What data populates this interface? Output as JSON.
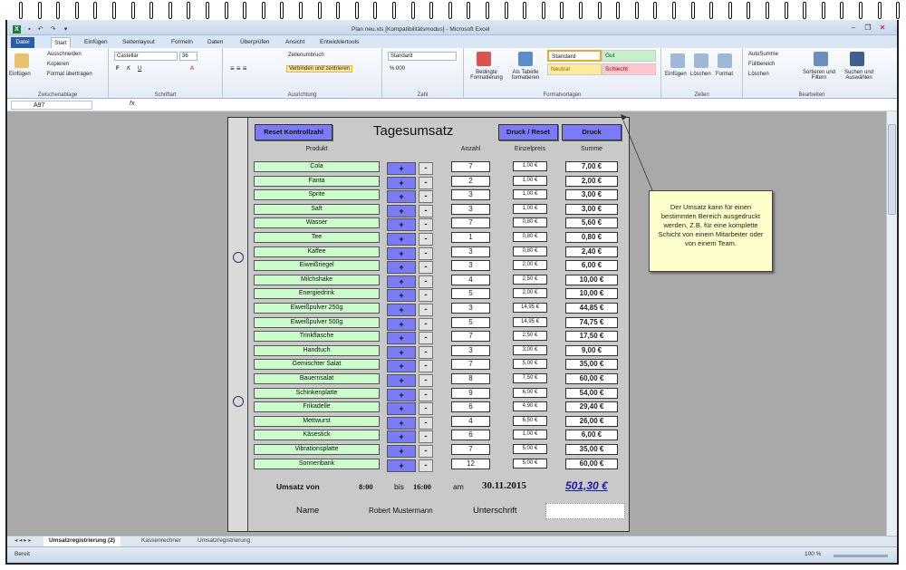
{
  "window": {
    "title": "Plan neu.xls  [Kompatibilitätsmodus]  -  Microsoft Excel"
  },
  "ribbon": {
    "tabs": [
      "Datei",
      "Start",
      "Einfügen",
      "Seitenlayout",
      "Formeln",
      "Daten",
      "Überprüfen",
      "Ansicht",
      "Entwicklertools"
    ],
    "clipboard": {
      "paste": "Einfügen",
      "cut": "Ausschneiden",
      "copy": "Kopieren",
      "format_painter": "Format übertragen",
      "group": "Zwischenablage"
    },
    "font": {
      "name": "Castellar",
      "size": "36",
      "group": "Schriftart"
    },
    "alignment": {
      "wrap": "Zeilenumbruch",
      "merge": "Verbinden und zentrieren",
      "group": "Ausrichtung"
    },
    "number": {
      "format": "Standard",
      "group": "Zahl"
    },
    "styles": {
      "conditional": "Bedingte Formatierung",
      "as_table": "Als Tabelle formatieren",
      "standard": "Standard",
      "gut": "Gut",
      "neutral": "Neutral",
      "schlecht": "Schlecht",
      "group": "Formatvorlagen"
    },
    "cells": {
      "insert": "Einfügen",
      "delete": "Löschen",
      "format": "Format",
      "group": "Zellen"
    },
    "editing": {
      "autosum": "AutoSumme",
      "fill": "Füllbereich",
      "clear": "Löschen",
      "sort": "Sortieren und Filtern",
      "find": "Suchen und Auswählen",
      "group": "Bearbeiten"
    }
  },
  "formula_bar": {
    "cell_ref": "A97",
    "fx": "fx",
    "content": ""
  },
  "sheet": {
    "title": "Tagesumsatz",
    "buttons": {
      "reset": "Reset Kontrollzahl",
      "print_reset": "Druck / Reset",
      "print": "Druck"
    },
    "headers": {
      "product": "Produkt",
      "qty": "Anzahl",
      "unit_price": "Einzelpreis",
      "sum": "Summe"
    },
    "plus_label": "+",
    "minus_label": "-",
    "rows": [
      {
        "product": "Cola",
        "qty": "7",
        "price": "1,00 €",
        "sum": "7,00 €"
      },
      {
        "product": "Fanta",
        "qty": "2",
        "price": "1,00 €",
        "sum": "2,00 €"
      },
      {
        "product": "Sprite",
        "qty": "3",
        "price": "1,00 €",
        "sum": "3,00 €"
      },
      {
        "product": "Saft",
        "qty": "3",
        "price": "1,00 €",
        "sum": "3,00 €"
      },
      {
        "product": "Wasser",
        "qty": "7",
        "price": "0,80 €",
        "sum": "5,60 €"
      },
      {
        "product": "Tee",
        "qty": "1",
        "price": "0,80 €",
        "sum": "0,80 €"
      },
      {
        "product": "Kaffee",
        "qty": "3",
        "price": "0,80 €",
        "sum": "2,40 €"
      },
      {
        "product": "Eiweißriegel",
        "qty": "3",
        "price": "2,00 €",
        "sum": "6,00 €"
      },
      {
        "product": "Milchshake",
        "qty": "4",
        "price": "2,50 €",
        "sum": "10,00 €"
      },
      {
        "product": "Energiedrink",
        "qty": "5",
        "price": "2,00 €",
        "sum": "10,00 €"
      },
      {
        "product": "Eiweißpulver 250g",
        "qty": "3",
        "price": "14,95 €",
        "sum": "44,85 €"
      },
      {
        "product": "Eiweißpulver 500g",
        "qty": "5",
        "price": "14,95 €",
        "sum": "74,75 €"
      },
      {
        "product": "Trinkflasche",
        "qty": "7",
        "price": "2,50 €",
        "sum": "17,50 €"
      },
      {
        "product": "Handtuch",
        "qty": "3",
        "price": "3,00 €",
        "sum": "9,00 €"
      },
      {
        "product": "Gemischter Salat",
        "qty": "7",
        "price": "5,00 €",
        "sum": "35,00 €"
      },
      {
        "product": "Bauernsalat",
        "qty": "8",
        "price": "7,50 €",
        "sum": "60,00 €"
      },
      {
        "product": "Schinkenplatte",
        "qty": "9",
        "price": "6,00 €",
        "sum": "54,00 €"
      },
      {
        "product": "Frikadelle",
        "qty": "6",
        "price": "4,90 €",
        "sum": "29,40 €"
      },
      {
        "product": "Mettwurst",
        "qty": "4",
        "price": "6,50 €",
        "sum": "26,00 €"
      },
      {
        "product": "Käsestick",
        "qty": "6",
        "price": "1,00 €",
        "sum": "6,00 €"
      },
      {
        "product": "Vibrationsplatte",
        "qty": "7",
        "price": "5,00 €",
        "sum": "35,00 €"
      },
      {
        "product": "Sonnenbank",
        "qty": "12",
        "price": "5,00 €",
        "sum": "60,00 €"
      }
    ],
    "footer": {
      "label_umsatz": "Umsatz von",
      "time_from": "8:00",
      "label_bis": "bis",
      "time_to": "16:00",
      "label_am": "am",
      "date": "30.11.2015",
      "total": "501,30 €",
      "label_name": "Name",
      "name": "Robert Mustermann",
      "label_signature": "Unterschrift"
    }
  },
  "callout": {
    "text": "Der Umsatz kann für einen bestimmten Bereich ausgedruckt werden, Z.B. für eine komplette Schicht von einem Mitarbeiter oder von einem Team."
  },
  "sheet_tabs": [
    "Umsatzregistrierung (2)",
    "Kassenrechner",
    "Umsatzregistrierung"
  ],
  "status": {
    "ready": "Bereit",
    "zoom": "100 %"
  }
}
